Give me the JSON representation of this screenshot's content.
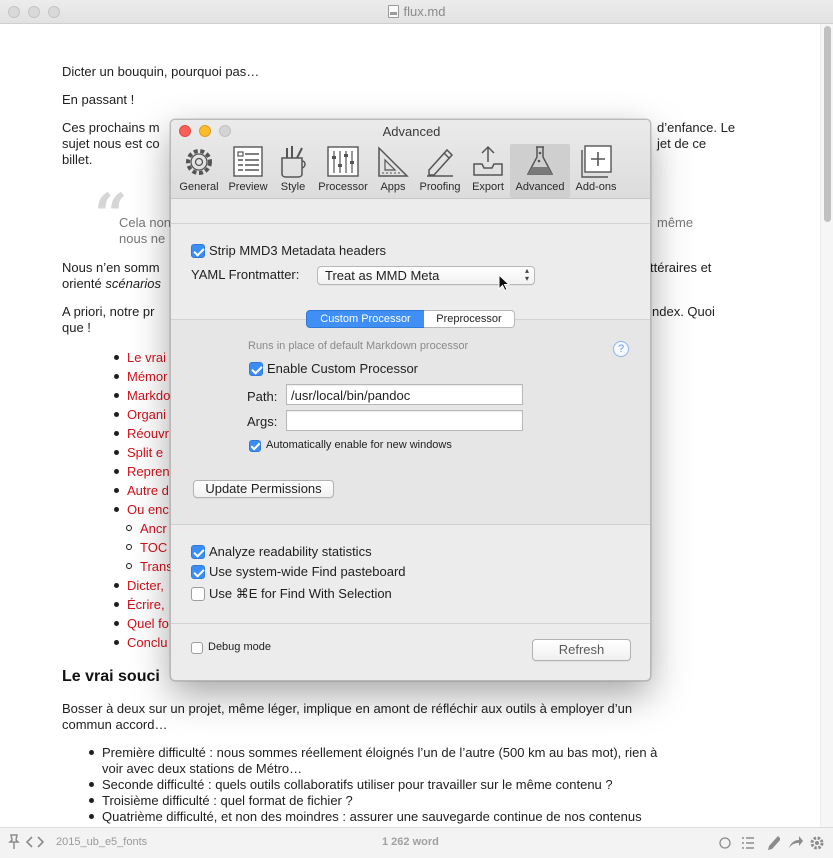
{
  "window": {
    "title": "flux.md"
  },
  "document": {
    "p1": "Dicter un bouquin, pourquoi pas…",
    "p2": "En passant !",
    "p3_left": "Ces prochains m",
    "p3_right": "d’enfance. Le",
    "p3b_left": "sujet nous est co",
    "p3b_right": "jet de ce",
    "p3c": "billet.",
    "quote_mark": "“",
    "bq1_left": "Cela non",
    "bq1_right": "même",
    "bq2_left": "nous ne",
    "p4_left": "Nous n’en somm",
    "p4_right": "ttéraires et",
    "p4b_left": "orienté ",
    "p4b_em": "scénarios",
    "p5_left": "A priori, notre pr",
    "p5_right": "ndex. Quoi",
    "p5b": "que !",
    "list": [
      "Le vrai",
      "Mémor",
      "Markdo",
      "Organi",
      "Réouvr",
      "Split e",
      "Repren",
      "Autre d",
      "Ou enc"
    ],
    "sublist": [
      "Ancr",
      "TOC",
      "Trans"
    ],
    "list2": [
      "Dicter,",
      "Écrire,",
      "Quel fo",
      "Conclu"
    ],
    "h2": "Le vrai souci",
    "p6": "Bosser à deux sur un projet, même léger, implique en amont de réfléchir aux outils à employer d’un",
    "p6b": "commun accord…",
    "bullets": [
      "Première difficulté : nous sommes réellement éloignés l’un de l’autre (500 km au bas mot), rien à",
      "voir avec deux stations de Métro…",
      "Seconde difficulté : quels outils collaboratifs utiliser pour travailler sur le même contenu ?",
      "Troisième difficulté : quel format de fichier ?",
      "Quatrième difficulté, et non des moindres : assurer une sauvegarde continue de nos contenus"
    ]
  },
  "statusbar": {
    "file": "2015_ub_e5_fonts",
    "word_count": "1 262 word"
  },
  "dialog": {
    "title": "Advanced",
    "toolbar": [
      {
        "label": "General",
        "icon": "gear-icon"
      },
      {
        "label": "Preview",
        "icon": "preview-icon"
      },
      {
        "label": "Style",
        "icon": "style-icon"
      },
      {
        "label": "Processor",
        "icon": "processor-icon"
      },
      {
        "label": "Apps",
        "icon": "apps-icon"
      },
      {
        "label": "Proofing",
        "icon": "proofing-icon"
      },
      {
        "label": "Export",
        "icon": "export-icon"
      },
      {
        "label": "Advanced",
        "icon": "flask-icon"
      },
      {
        "label": "Add-ons",
        "icon": "addons-icon"
      }
    ],
    "strip_label": "Strip MMD3 Metadata headers",
    "yaml_label": "YAML Frontmatter:",
    "yaml_value": "Treat as MMD Meta",
    "seg_custom": "Custom Processor",
    "seg_pre": "Preprocessor",
    "runs_hint": "Runs in place of default Markdown processor",
    "help": "?",
    "enable_label": "Enable Custom Processor",
    "path_label": "Path:",
    "path_value": "/usr/local/bin/pandoc",
    "args_label": "Args:",
    "args_value": "",
    "auto_label": "Automatically enable for new windows",
    "update_btn": "Update Permissions",
    "readability_label": "Analyze readability statistics",
    "find_label": "Use system-wide Find pasteboard",
    "cmd_label": "Use ⌘E for Find With Selection",
    "debug_label": "Debug mode",
    "refresh_btn": "Refresh"
  },
  "colors": {
    "accent": "#3a8ef6",
    "link_red": "#d0111b"
  }
}
